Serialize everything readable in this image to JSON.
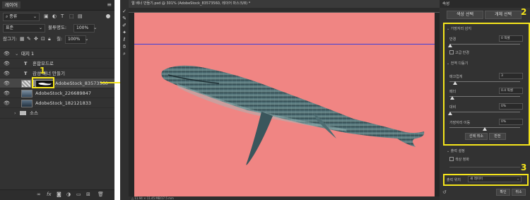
{
  "layers_panel": {
    "tab_label": "레이어",
    "kind_select": "종류",
    "blend_mode": "표준",
    "opacity_label": "불투명도:",
    "opacity_value": "100%",
    "lock_label": "잠그기:",
    "fill_label": "칠:",
    "fill_value": "100%",
    "layers": [
      {
        "name": "대지 1"
      },
      {
        "name": "혼합모드로"
      },
      {
        "name": "감성 배너 만들기"
      },
      {
        "name": "AdobeStock_83573560"
      },
      {
        "name": "AdobeStock_226689847"
      },
      {
        "name": "AdobeStock_182121833"
      },
      {
        "name": "소스"
      }
    ]
  },
  "document": {
    "tab_title": "웹 배너 만들기.psd @ 301% (AdobeStock_83573560, 레이어 마스크/8) *",
    "status_text": "△ 11.94 × 11.45 MB/17.5 mm"
  },
  "properties_panel": {
    "tab_label": "속성",
    "mask_tab_1": "색상 선택",
    "mask_tab_2": "개체 선택",
    "section_edge_detect": "가장자리 감지",
    "radius_label": "반경",
    "radius_value": "0 픽셀",
    "smart_radius_label": "고급 반경",
    "section_global": "전역 다듬기",
    "smooth_label": "매끄럽게",
    "smooth_value": "3",
    "feather_label": "페더",
    "feather_value": "0.4 픽셀",
    "contrast_label": "대비",
    "contrast_value": "0%",
    "shift_edge_label": "가장자리 이동",
    "shift_edge_value": "0%",
    "clear_selection": "선택 취소",
    "invert": "반전",
    "section_output": "출력 설정",
    "decontaminate_label": "색상 정화",
    "output_to_label": "출력 위치",
    "output_to_value": "새 레이어",
    "ok_label": "확인",
    "cancel_label": "취소"
  },
  "annotations": {
    "callout_1": "1",
    "callout_2": "2",
    "callout_3": "3",
    "highlight_color": "#f5e51c"
  }
}
